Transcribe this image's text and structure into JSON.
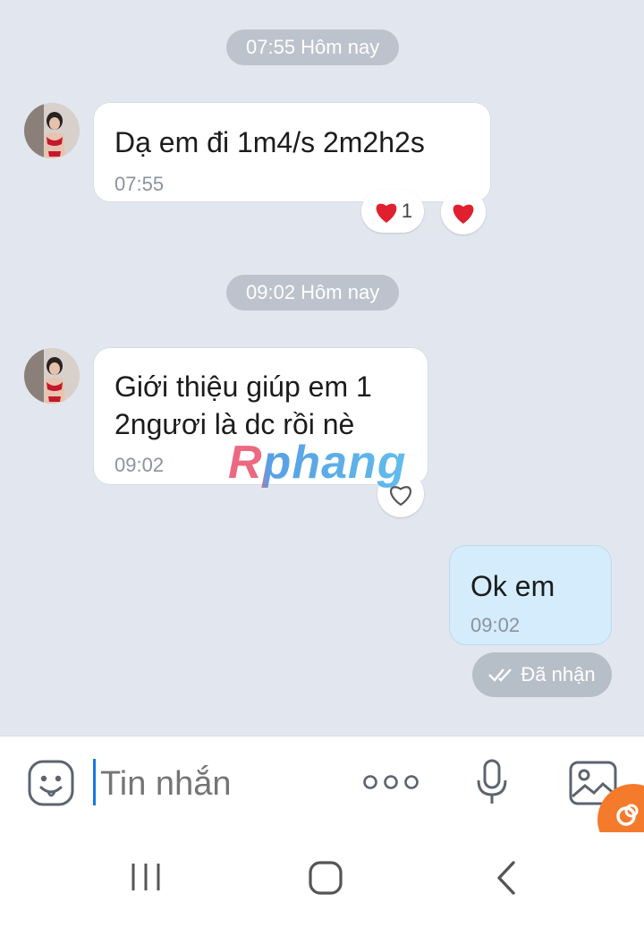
{
  "messages": [
    {
      "time_pill": "07:55 Hôm nay",
      "text": "Dạ em đi 1m4/s 2m2h2s",
      "time": "07:55",
      "reaction_count": "1"
    },
    {
      "time_pill": "09:02 Hôm nay",
      "text_line1": "Giới thiệu giúp em 1",
      "text_line2": "2ngươi là dc rồi nè",
      "time": "09:02"
    },
    {
      "text": "Ok em",
      "time": "09:02",
      "status": "Đã nhận"
    }
  ],
  "watermark": "Rphang",
  "input": {
    "placeholder": "Tin nhắn"
  },
  "colors": {
    "background": "#e2e7ef",
    "my_bubble": "#d4ecfb",
    "accent": "#1677e6",
    "heart": "#e0202f"
  },
  "icons": [
    "emoji-icon",
    "more-icon",
    "microphone-icon",
    "image-icon",
    "recent-apps-icon",
    "home-icon",
    "back-icon"
  ]
}
